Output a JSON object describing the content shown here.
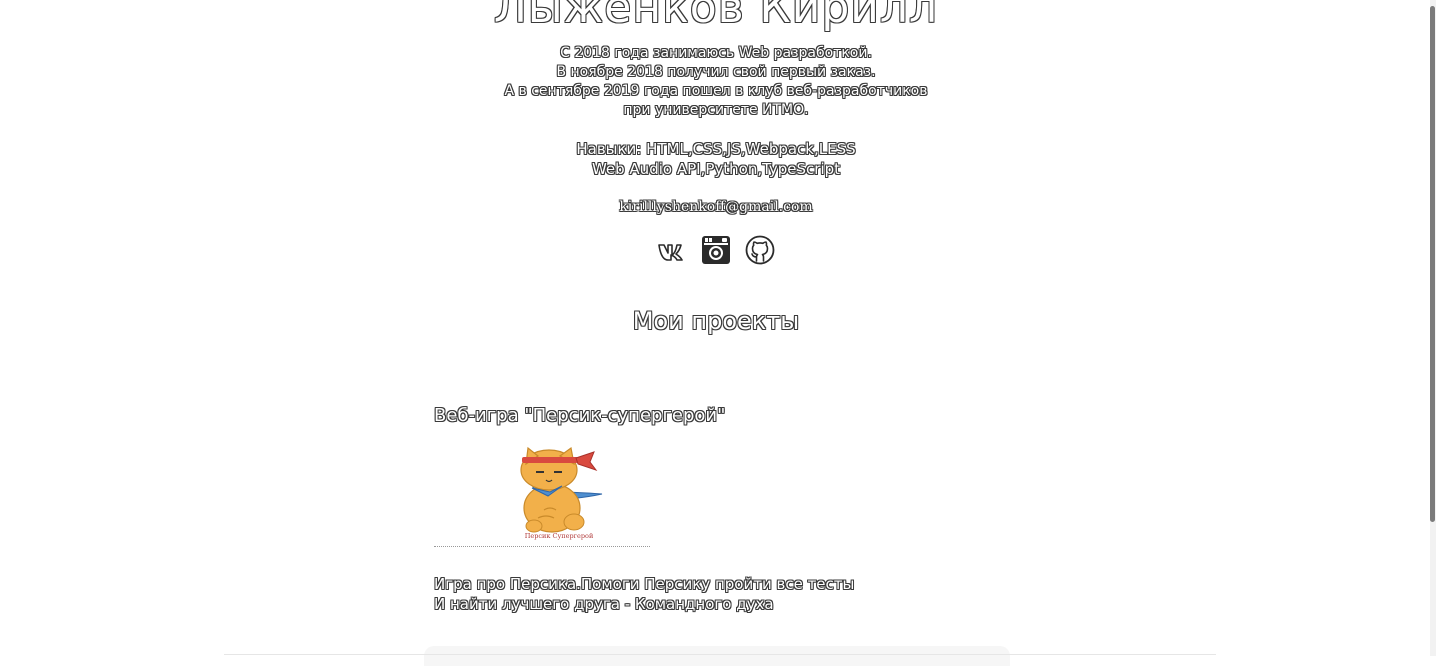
{
  "profile": {
    "name": "Лыженков Кирилл",
    "bio": [
      "С 2018 года занимаюсь Web разработкой.",
      "В ноябре 2018 получил свой первый заказ.",
      "А в сентябре 2019 года пошел в клуб веб-разработчиков",
      "при университете ИТМО."
    ],
    "skills": [
      "Навыки: HTML,CSS,JS,Webpack,LESS",
      "Web Audio API,Python,TypeScript"
    ],
    "email": "kirilllyshenkoff@gmail.com"
  },
  "socials": [
    {
      "icon": "vk-icon"
    },
    {
      "icon": "instagram-icon"
    },
    {
      "icon": "github-icon"
    }
  ],
  "projects": {
    "title": "Мои проекты",
    "items": [
      {
        "title": "Веб-игра \"Персик-супергерой\"",
        "image_caption": "Персик Супергерой",
        "description": [
          "Игра про Персика.Помоги Персику пройти все тесты",
          "И найти лучшего друга - Командного духа"
        ]
      }
    ]
  },
  "colors": {
    "text_outline": "#3a3a3a",
    "cat_orange": "#f2b04a",
    "headband_red": "#d94a3f",
    "scarf_blue": "#4f8fd0",
    "scroll_thumb": "#7b7b7b"
  }
}
